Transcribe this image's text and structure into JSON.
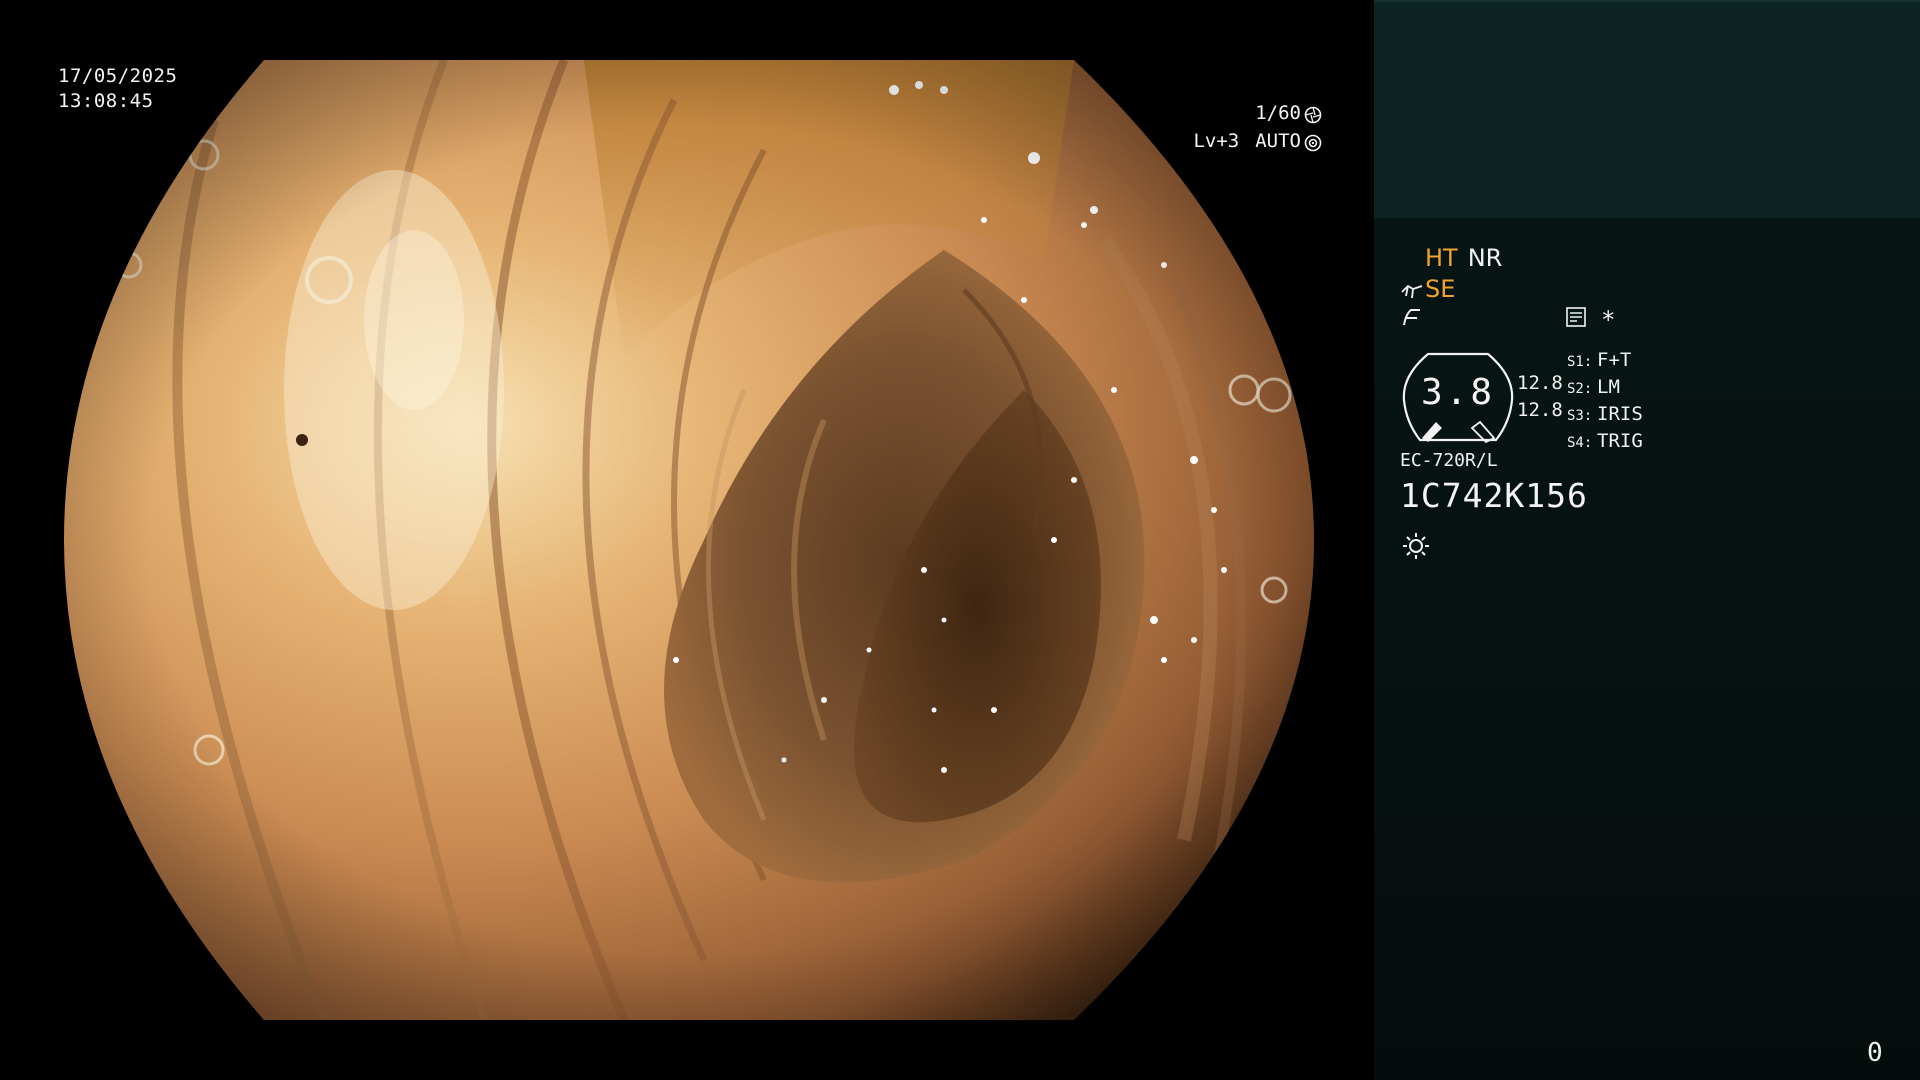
{
  "overlay": {
    "date": "17/05/2025",
    "time": "13:08:45",
    "shutter": "1/60",
    "level": "Lv+3",
    "iris_mode": "AUTO"
  },
  "panel": {
    "mode_ht": "HT",
    "mode_nr": "NR",
    "mode_se": "SE",
    "asterisk": "*",
    "gauge_value": "3.8",
    "gauge_side_top": "12.8",
    "gauge_side_bottom": "12.8",
    "switches": [
      {
        "key": "S1:",
        "value": "F+T"
      },
      {
        "key": "S2:",
        "value": "LM"
      },
      {
        "key": "S3:",
        "value": "IRIS"
      },
      {
        "key": "S4:",
        "value": "TRIG"
      }
    ],
    "scope_model": "EC-720R/L",
    "serial": "1C742K156",
    "page_counter": "0"
  },
  "colors": {
    "accent_orange": "#f0a330",
    "panel_top": "#0c2424",
    "panel_bg": "#061110"
  },
  "icons": [
    "shutter-icon",
    "iris-icon",
    "mode-hand-icon",
    "enhance-icon",
    "memo-icon",
    "light-icon"
  ]
}
